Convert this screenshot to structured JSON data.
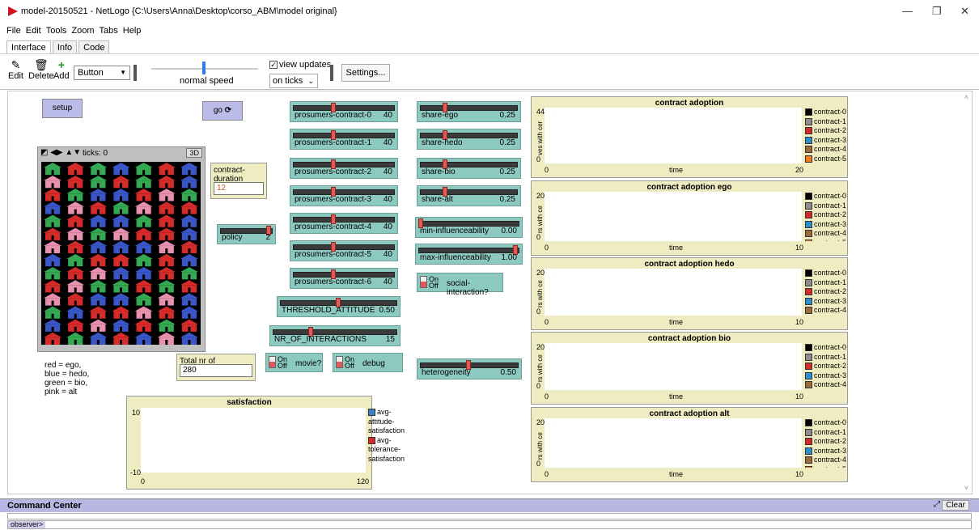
{
  "window": {
    "title": "model-20150521 - NetLogo {C:\\Users\\Anna\\Desktop\\corso_ABM\\model original}",
    "minimize": "—",
    "restore": "❐",
    "close": "✕"
  },
  "menu": [
    "File",
    "Edit",
    "Tools",
    "Zoom",
    "Tabs",
    "Help"
  ],
  "tabs": [
    "Interface",
    "Info",
    "Code"
  ],
  "toolbar": {
    "edit": "Edit",
    "delete": "Delete",
    "add": "Add",
    "widget_type": "Button",
    "speed_label": "normal speed",
    "speed_fraction": 0.5,
    "view_updates": "view updates",
    "view_updates_checked": true,
    "update_mode": "on ticks",
    "settings": "Settings..."
  },
  "buttons": {
    "setup": "setup",
    "go": "go"
  },
  "view": {
    "ticks_label": "ticks: 0",
    "three_d": "3D",
    "legend": [
      "red = ego,",
      "blue = hedo,",
      "green = bio,",
      "pink = alt"
    ]
  },
  "inputs": {
    "contract_duration": {
      "label": "contract-duration",
      "value": "12"
    },
    "total_prosumers": {
      "label": "Total nr of prosumers",
      "value": "280"
    }
  },
  "sliders": {
    "policy": {
      "label": "policy",
      "value": "2",
      "fraction": 1.0
    },
    "pc0": {
      "label": "prosumers-contract-0",
      "value": "40",
      "fraction": 0.4
    },
    "pc1": {
      "label": "prosumers-contract-1",
      "value": "40",
      "fraction": 0.4
    },
    "pc2": {
      "label": "prosumers-contract-2",
      "value": "40",
      "fraction": 0.4
    },
    "pc3": {
      "label": "prosumers-contract-3",
      "value": "40",
      "fraction": 0.4
    },
    "pc4": {
      "label": "prosumers-contract-4",
      "value": "40",
      "fraction": 0.4
    },
    "pc5": {
      "label": "prosumers-contract-5",
      "value": "40",
      "fraction": 0.4
    },
    "pc6": {
      "label": "prosumers-contract-6",
      "value": "40",
      "fraction": 0.4
    },
    "threshold": {
      "label": "THRESHOLD_ATTITUDE",
      "value": "0.50",
      "fraction": 0.5
    },
    "interactions": {
      "label": "NR_OF_INTERACTIONS",
      "value": "15",
      "fraction": 0.3
    },
    "share_ego": {
      "label": "share-ego",
      "value": "0.25",
      "fraction": 0.25
    },
    "share_hedo": {
      "label": "share-hedo",
      "value": "0.25",
      "fraction": 0.25
    },
    "share_bio": {
      "label": "share-bio",
      "value": "0.25",
      "fraction": 0.25
    },
    "share_alt": {
      "label": "share-alt",
      "value": "0.25",
      "fraction": 0.25
    },
    "min_infl": {
      "label": "min-influenceability",
      "value": "0.00",
      "fraction": 0.0
    },
    "max_infl": {
      "label": "max-influenceability",
      "value": "1.00",
      "fraction": 1.0
    },
    "heterogeneity": {
      "label": "heterogeneity",
      "value": "0.50",
      "fraction": 0.5
    }
  },
  "switches": {
    "social": {
      "label": "social-interaction?",
      "on": "On",
      "off": "Off"
    },
    "movie": {
      "label": "movie?",
      "on": "On",
      "off": "Off"
    },
    "debug": {
      "label": "debug",
      "on": "On",
      "off": "Off"
    }
  },
  "plots": {
    "satisfaction": {
      "title": "satisfaction",
      "ymax": "10",
      "ymin": "-10",
      "xmin": "0",
      "xmax": "120",
      "legend": [
        {
          "name": "avg-attitude-satisfaction",
          "color": "#3a7ec4"
        },
        {
          "name": "avg-tolerance-satisfaction",
          "color": "#d42a2a"
        }
      ]
    },
    "adoption": {
      "title": "contract adoption",
      "ymax": "44",
      "ymin": "0",
      "xmin": "0",
      "xmax": "20",
      "xlabel": "time",
      "ylabel": "ves with cer"
    },
    "ego": {
      "title": "contract adoption ego",
      "ymax": "20",
      "ymin": "0",
      "xmin": "0",
      "xmax": "10",
      "xlabel": "time",
      "ylabel": "rs with ce"
    },
    "hedo": {
      "title": "contract adoption hedo",
      "ymax": "20",
      "ymin": "0",
      "xmin": "0",
      "xmax": "10",
      "xlabel": "time",
      "ylabel": "rs with ce"
    },
    "bio": {
      "title": "contract adoption bio",
      "ymax": "20",
      "ymin": "0",
      "xmin": "0",
      "xmax": "10",
      "xlabel": "time",
      "ylabel": "rs with ce"
    },
    "alt": {
      "title": "contract adoption alt",
      "ymax": "20",
      "ymin": "0",
      "xmin": "0",
      "xmax": "10",
      "xlabel": "time",
      "ylabel": "rs with ce"
    }
  },
  "contract_legend": [
    {
      "name": "contract-0",
      "color": "#000000"
    },
    {
      "name": "contract-1",
      "color": "#8c8c8c"
    },
    {
      "name": "contract-2",
      "color": "#d42a2a"
    },
    {
      "name": "contract-3",
      "color": "#2b8fce"
    },
    {
      "name": "contract-4",
      "color": "#9d6a3a"
    },
    {
      "name": "contract-5",
      "color": "#f07a1a"
    }
  ],
  "command_center": {
    "title": "Command Center",
    "clear": "Clear",
    "prompt": "observer>"
  }
}
